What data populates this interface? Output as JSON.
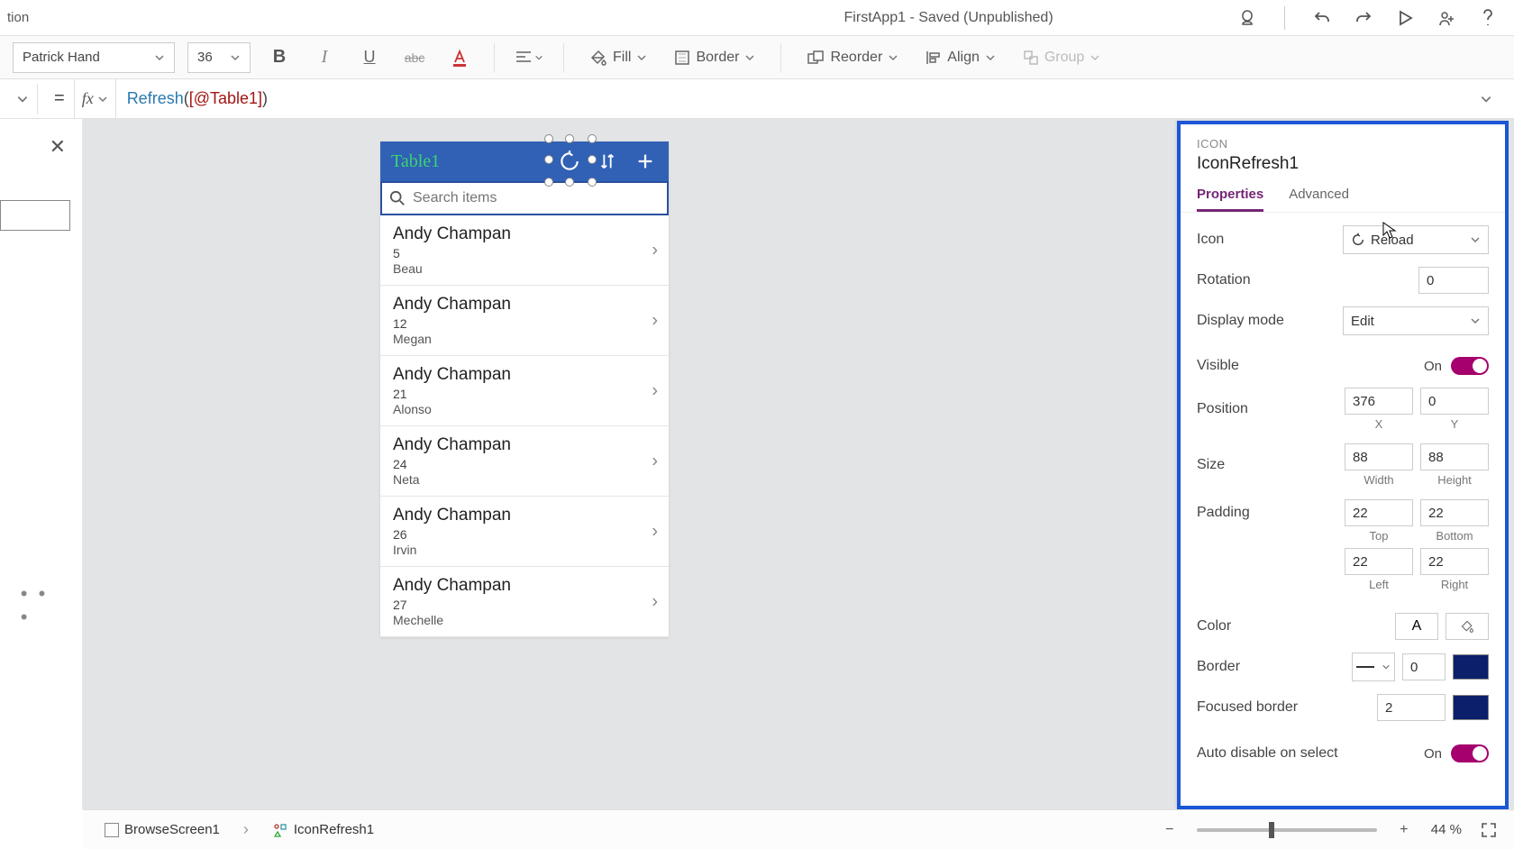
{
  "titlebar": {
    "left_fragment": "tion",
    "title": "FirstApp1 - Saved (Unpublished)"
  },
  "ribbon": {
    "font": "Patrick Hand",
    "size": "36",
    "fill_label": "Fill",
    "border_label": "Border",
    "reorder_label": "Reorder",
    "align_label": "Align",
    "group_label": "Group"
  },
  "formula": {
    "fn": "Refresh",
    "arg": "[@Table1]"
  },
  "phone": {
    "title": "Table1",
    "search_placeholder": "Search items",
    "items": [
      {
        "title": "Andy Champan",
        "line2": "5",
        "line3": "Beau"
      },
      {
        "title": "Andy Champan",
        "line2": "12",
        "line3": "Megan"
      },
      {
        "title": "Andy Champan",
        "line2": "21",
        "line3": "Alonso"
      },
      {
        "title": "Andy Champan",
        "line2": "24",
        "line3": "Neta"
      },
      {
        "title": "Andy Champan",
        "line2": "26",
        "line3": "Irvin"
      },
      {
        "title": "Andy Champan",
        "line2": "27",
        "line3": "Mechelle"
      }
    ]
  },
  "panel": {
    "type": "ICON",
    "name": "IconRefresh1",
    "tabs": {
      "properties": "Properties",
      "advanced": "Advanced"
    },
    "props": {
      "icon_label": "Icon",
      "icon_value": "Reload",
      "rotation_label": "Rotation",
      "rotation_value": "0",
      "display_mode_label": "Display mode",
      "display_mode_value": "Edit",
      "visible_label": "Visible",
      "visible_state": "On",
      "position_label": "Position",
      "pos_x": "376",
      "pos_y": "0",
      "pos_x_sub": "X",
      "pos_y_sub": "Y",
      "size_label": "Size",
      "size_w": "88",
      "size_h": "88",
      "size_w_sub": "Width",
      "size_h_sub": "Height",
      "padding_label": "Padding",
      "pad_t": "22",
      "pad_b": "22",
      "pad_l": "22",
      "pad_r": "22",
      "pad_t_sub": "Top",
      "pad_b_sub": "Bottom",
      "pad_l_sub": "Left",
      "pad_r_sub": "Right",
      "color_label": "Color",
      "border_label": "Border",
      "border_val": "0",
      "border_color": "#0b1f6b",
      "focused_border_label": "Focused border",
      "focused_border_val": "2",
      "focused_border_color": "#0b1f6b",
      "auto_disable_label": "Auto disable on select",
      "auto_disable_state": "On"
    }
  },
  "statusbar": {
    "crumb1": "BrowseScreen1",
    "crumb2": "IconRefresh1",
    "zoom": "44",
    "zoom_pct": "%"
  }
}
